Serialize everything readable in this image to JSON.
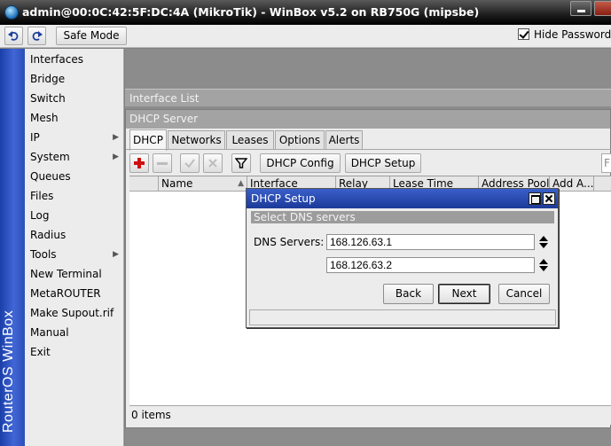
{
  "window": {
    "title": "admin@00:0C:42:5F:DC:4A (MikroTik) - WinBox v5.2 on RB750G (mipsbe)"
  },
  "toolbar": {
    "safe_mode_label": "Safe Mode",
    "hide_passwords_label": "Hide Passwords"
  },
  "brand": "RouterOS WinBox",
  "sidebar": {
    "items": [
      {
        "label": "Interfaces"
      },
      {
        "label": "Bridge"
      },
      {
        "label": "Switch"
      },
      {
        "label": "Mesh"
      },
      {
        "label": "IP"
      },
      {
        "label": "System"
      },
      {
        "label": "Queues"
      },
      {
        "label": "Files"
      },
      {
        "label": "Log"
      },
      {
        "label": "Radius"
      },
      {
        "label": "Tools"
      },
      {
        "label": "New Terminal"
      },
      {
        "label": "MetaROUTER"
      },
      {
        "label": "Make Supout.rif"
      },
      {
        "label": "Manual"
      },
      {
        "label": "Exit"
      }
    ]
  },
  "interface_list": {
    "title": "Interface List"
  },
  "dhcp_server": {
    "title": "DHCP Server",
    "tabs": [
      "DHCP",
      "Networks",
      "Leases",
      "Options",
      "Alerts"
    ],
    "dhcp_config_label": "DHCP Config",
    "dhcp_setup_label": "DHCP Setup",
    "find_placeholder": "F",
    "columns": [
      "Name",
      "Interface",
      "Relay",
      "Lease Time",
      "Address Pool",
      "Add A..."
    ],
    "status": "0 items"
  },
  "dialog": {
    "title": "DHCP Setup",
    "subtitle": "Select DNS servers",
    "dns_label": "DNS Servers:",
    "dns_servers": [
      "168.126.63.1",
      "168.126.63.2"
    ],
    "back_label": "Back",
    "next_label": "Next",
    "cancel_label": "Cancel"
  },
  "colors": {
    "brand_blue": "#1a3fa8",
    "dialog_title_blue": "#1b3a99",
    "add_red": "#d01010"
  }
}
